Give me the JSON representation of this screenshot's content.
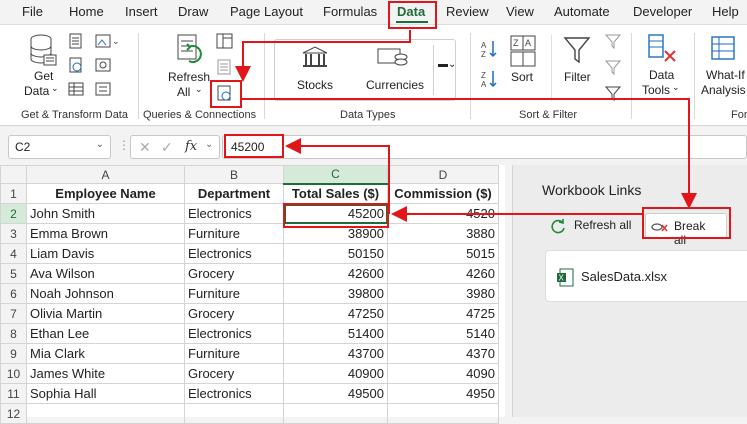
{
  "menu": [
    "File",
    "Home",
    "Insert",
    "Draw",
    "Page Layout",
    "Formulas",
    "Data",
    "Review",
    "View",
    "Automate",
    "Developer",
    "Help"
  ],
  "ribbon": {
    "get_data": "Get",
    "get_data_2": "Data",
    "refresh": "Refresh",
    "refresh_2": "All",
    "stocks": "Stocks",
    "currencies": "Currencies",
    "sort": "Sort",
    "filter": "Filter",
    "data_tools": "Data",
    "data_tools_2": "Tools",
    "whatif": "What-If",
    "whatif_2": "Analysis",
    "groups": [
      "Get & Transform Data",
      "Queries & Connections",
      "Data Types",
      "Sort & Filter",
      "For"
    ]
  },
  "formula_bar": {
    "name_box": "C2",
    "value": "45200"
  },
  "sheet": {
    "columns": [
      "A",
      "B",
      "C",
      "D"
    ],
    "headers": [
      "Employee Name",
      "Department",
      "Total Sales ($)",
      "Commission ($)"
    ],
    "rows": [
      [
        "John Smith",
        "Electronics",
        "45200",
        "4520"
      ],
      [
        "Emma Brown",
        "Furniture",
        "38900",
        "3880"
      ],
      [
        "Liam Davis",
        "Electronics",
        "50150",
        "5015"
      ],
      [
        "Ava Wilson",
        "Grocery",
        "42600",
        "4260"
      ],
      [
        "Noah Johnson",
        "Furniture",
        "39800",
        "3980"
      ],
      [
        "Olivia Martin",
        "Grocery",
        "47250",
        "4725"
      ],
      [
        "Ethan Lee",
        "Electronics",
        "51400",
        "5140"
      ],
      [
        "Mia Clark",
        "Furniture",
        "43700",
        "4370"
      ],
      [
        "James White",
        "Grocery",
        "40900",
        "4090"
      ],
      [
        "Sophia Hall",
        "Electronics",
        "49500",
        "4950"
      ]
    ],
    "row_numbers": [
      "1",
      "2",
      "3",
      "4",
      "5",
      "6",
      "7",
      "8",
      "9",
      "10",
      "11",
      "12"
    ]
  },
  "panel": {
    "title": "Workbook Links",
    "refresh_all": "Refresh all",
    "break_all": "Break all",
    "file": "SalesData.xlsx"
  },
  "colors": {
    "accent": "#1e6b3b",
    "annotation": "#e0161b"
  }
}
